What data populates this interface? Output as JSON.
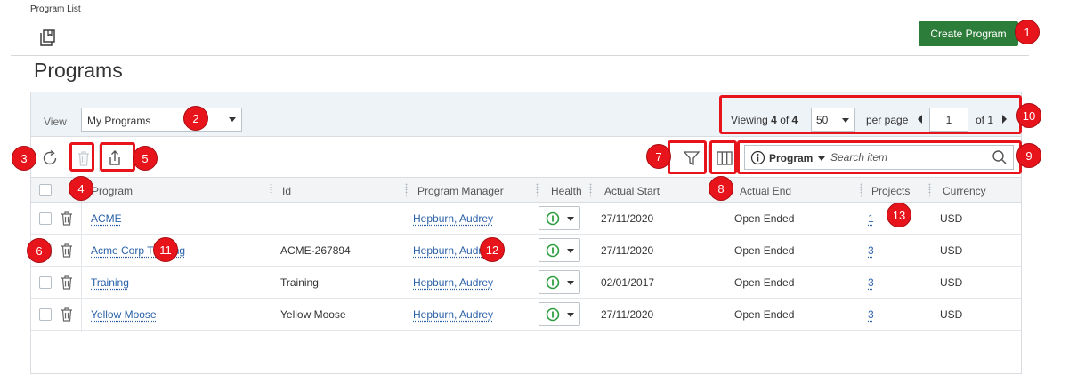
{
  "breadcrumb": "Program List",
  "create_button": "Create Program",
  "page_title": "Programs",
  "view": {
    "label": "View",
    "selected": "My Programs"
  },
  "pager": {
    "viewing": "Viewing",
    "shown": "4",
    "of_label": "of",
    "total": "4",
    "page_size": "50",
    "per_page": "per page",
    "page": "1",
    "page_of": "of 1"
  },
  "search": {
    "scope": "Program",
    "placeholder": "Search item"
  },
  "columns": [
    "Program",
    "Id",
    "Program Manager",
    "Health",
    "Actual Start",
    "Actual End",
    "Projects",
    "Currency"
  ],
  "rows": [
    {
      "program": "ACME",
      "id": "",
      "manager": "Hepburn, Audrey",
      "start": "27/11/2020",
      "end": "Open Ended",
      "projects": "1",
      "currency": "USD"
    },
    {
      "program": "Acme Corp Training",
      "id": "ACME-267894",
      "manager": "Hepburn, Audrey",
      "start": "27/11/2020",
      "end": "Open Ended",
      "projects": "3",
      "currency": "USD"
    },
    {
      "program": "Training",
      "id": "Training",
      "manager": "Hepburn, Audrey",
      "start": "02/01/2017",
      "end": "Open Ended",
      "projects": "3",
      "currency": "USD"
    },
    {
      "program": "Yellow Moose",
      "id": "Yellow Moose",
      "manager": "Hepburn, Audrey",
      "start": "27/11/2020",
      "end": "Open Ended",
      "projects": "3",
      "currency": "USD"
    }
  ],
  "callouts": [
    "1",
    "2",
    "3",
    "4",
    "5",
    "6",
    "7",
    "8",
    "9",
    "10",
    "11",
    "12",
    "13"
  ],
  "colors": {
    "accent_green": "#2d7d3a",
    "link_blue": "#2a62a8",
    "callout_red": "#e8141c",
    "health_green": "#2e9e3e"
  },
  "icons": {
    "page": "book-icon",
    "refresh": "refresh-icon",
    "delete": "trash-icon",
    "export": "export-icon",
    "filter": "filter-icon",
    "columns": "columns-icon",
    "info": "info-icon",
    "search": "search-icon",
    "health": "health-status-icon"
  }
}
